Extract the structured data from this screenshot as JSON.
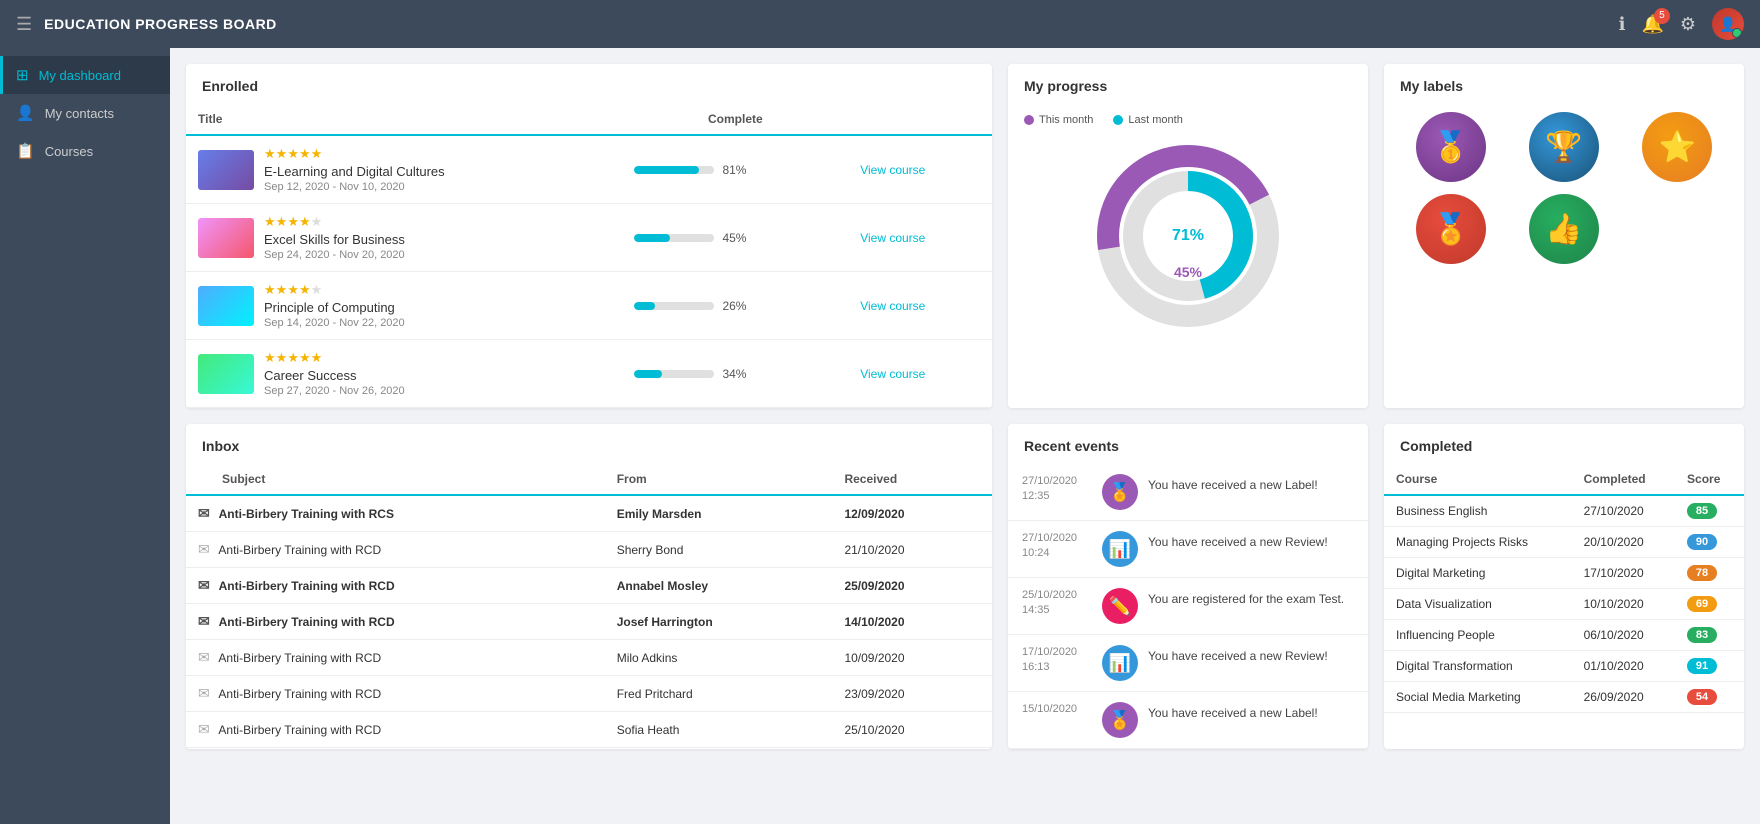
{
  "topbar": {
    "title": "EDUCATION PROGRESS BOARD",
    "notifications": "5"
  },
  "sidebar": {
    "items": [
      {
        "label": "My dashboard",
        "icon": "⊞",
        "active": true
      },
      {
        "label": "My contacts",
        "icon": "👤",
        "active": false
      },
      {
        "label": "Courses",
        "icon": "📋",
        "active": false
      }
    ]
  },
  "enrolled": {
    "section_title": "Enrolled",
    "columns": [
      "Title",
      "Complete"
    ],
    "courses": [
      {
        "name": "E-Learning and Digital Cultures",
        "date": "Sep 12, 2020 - Nov 10, 2020",
        "stars": 5,
        "progress": 81,
        "thumb_class": "thumb-elearning",
        "view_label": "View course"
      },
      {
        "name": "Excel Skills for Business",
        "date": "Sep 24, 2020 - Nov 20, 2020",
        "stars": 4,
        "progress": 45,
        "thumb_class": "thumb-excel",
        "view_label": "View course"
      },
      {
        "name": "Principle of Computing",
        "date": "Sep 14, 2020 - Nov 22, 2020",
        "stars": 4,
        "progress": 26,
        "thumb_class": "thumb-computing",
        "view_label": "View course"
      },
      {
        "name": "Career Success",
        "date": "Sep 27, 2020 - Nov 26, 2020",
        "stars": 5,
        "progress": 34,
        "thumb_class": "thumb-career",
        "view_label": "View course"
      }
    ]
  },
  "my_progress": {
    "title": "My progress",
    "legend": [
      {
        "label": "This month",
        "color": "#9b59b6"
      },
      {
        "label": "Last month",
        "color": "#00bcd4"
      }
    ],
    "this_month_pct": "45%",
    "last_month_pct": "71%"
  },
  "my_labels": {
    "title": "My labels",
    "badges": [
      {
        "emoji": "🥇",
        "class": "badge-gold"
      },
      {
        "emoji": "🏆",
        "class": "badge-trophy"
      },
      {
        "emoji": "⭐",
        "class": "badge-star"
      },
      {
        "emoji": "🏅",
        "class": "badge-ribbon"
      },
      {
        "emoji": "👍",
        "class": "badge-thumb"
      }
    ]
  },
  "inbox": {
    "title": "Inbox",
    "columns": [
      "Subject",
      "From",
      "Received"
    ],
    "messages": [
      {
        "subject": "Anti-Birbery Training with RCS",
        "from": "Emily Marsden",
        "received": "12/09/2020",
        "unread": true
      },
      {
        "subject": "Anti-Birbery Training with RCD",
        "from": "Sherry Bond",
        "received": "21/10/2020",
        "unread": false
      },
      {
        "subject": "Anti-Birbery Training with RCD",
        "from": "Annabel Mosley",
        "received": "25/09/2020",
        "unread": true
      },
      {
        "subject": "Anti-Birbery Training with RCD",
        "from": "Josef Harrington",
        "received": "14/10/2020",
        "unread": true
      },
      {
        "subject": "Anti-Birbery Training with RCD",
        "from": "Milo Adkins",
        "received": "10/09/2020",
        "unread": false
      },
      {
        "subject": "Anti-Birbery Training with RCD",
        "from": "Fred Pritchard",
        "received": "23/09/2020",
        "unread": false
      },
      {
        "subject": "Anti-Birbery Training with RCD",
        "from": "Sofia Heath",
        "received": "25/10/2020",
        "unread": false
      }
    ]
  },
  "recent_events": {
    "title": "Recent events",
    "events": [
      {
        "date": "27/10/2020",
        "time": "12:35",
        "icon": "🏅",
        "icon_class": "eic-purple",
        "text": "You have received a new Label!"
      },
      {
        "date": "27/10/2020",
        "time": "10:24",
        "icon": "📊",
        "icon_class": "eic-blue",
        "text": "You have received a new Review!"
      },
      {
        "date": "25/10/2020",
        "time": "14:35",
        "icon": "✏️",
        "icon_class": "eic-pink",
        "text": "You are registered for the exam Test."
      },
      {
        "date": "17/10/2020",
        "time": "16:13",
        "icon": "📊",
        "icon_class": "eic-blue",
        "text": "You have received a new Review!"
      },
      {
        "date": "15/10/2020",
        "time": "",
        "icon": "🏅",
        "icon_class": "eic-purple",
        "text": "You have received a new Label!"
      }
    ]
  },
  "completed": {
    "title": "Completed",
    "columns": [
      "Course",
      "Completed",
      "Score"
    ],
    "courses": [
      {
        "name": "Business English",
        "date": "27/10/2020",
        "score": 85,
        "score_class": "score-green"
      },
      {
        "name": "Managing Projects Risks",
        "date": "20/10/2020",
        "score": 90,
        "score_class": "score-blue"
      },
      {
        "name": "Digital Marketing",
        "date": "17/10/2020",
        "score": 78,
        "score_class": "score-orange"
      },
      {
        "name": "Data Visualization",
        "date": "10/10/2020",
        "score": 69,
        "score_class": "score-yellow"
      },
      {
        "name": "Influencing People",
        "date": "06/10/2020",
        "score": 83,
        "score_class": "score-green"
      },
      {
        "name": "Digital Transformation",
        "date": "01/10/2020",
        "score": 91,
        "score_class": "score-teal"
      },
      {
        "name": "Social Media Marketing",
        "date": "26/09/2020",
        "score": 54,
        "score_class": "score-red"
      }
    ]
  }
}
